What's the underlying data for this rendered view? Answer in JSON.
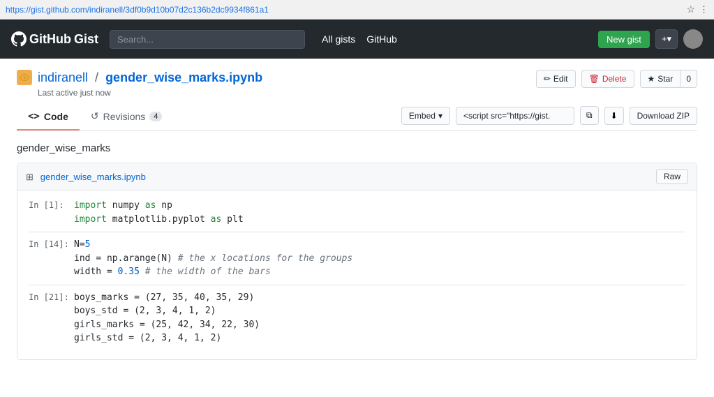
{
  "addressBar": {
    "url": "https://gist.github.com/indiranell/3df0b9d10b07d2c136b2dc9934f861a1"
  },
  "header": {
    "logo": {
      "github": "GitHub",
      "gist": "Gist"
    },
    "search": {
      "placeholder": "Search..."
    },
    "nav": [
      {
        "label": "All gists"
      },
      {
        "label": "GitHub"
      }
    ],
    "newGist": "New gist",
    "plusBtn": "+"
  },
  "gist": {
    "owner": "indiranell",
    "separator": "/",
    "filename": "gender_wise_marks.ipynb",
    "lastActive": "Last active just now",
    "actions": {
      "edit": "Edit",
      "delete": "Delete",
      "star": "Star",
      "starCount": "0"
    }
  },
  "tabs": [
    {
      "label": "Code",
      "icon": "<>",
      "active": true
    },
    {
      "label": "Revisions",
      "icon": "↺",
      "count": "4",
      "active": false
    }
  ],
  "tabActions": {
    "embed": "Embed",
    "embedDropdownIcon": "▾",
    "embedValue": "<script src=\"https://gist.",
    "downloadZip": "Download ZIP"
  },
  "gistName": "gender_wise_marks",
  "file": {
    "name": "gender_wise_marks.ipynb",
    "rawBtn": "Raw"
  },
  "codeCells": [
    {
      "label": "In [1]:",
      "lines": [
        {
          "tokens": [
            {
              "text": "import ",
              "class": "code-green"
            },
            {
              "text": "numpy",
              "class": "code-black"
            },
            {
              "text": " as ",
              "class": "code-green"
            },
            {
              "text": "np",
              "class": "code-black"
            }
          ]
        },
        {
          "tokens": [
            {
              "text": "import ",
              "class": "code-green"
            },
            {
              "text": "matplotlib.pyplot",
              "class": "code-black"
            },
            {
              "text": " as ",
              "class": "code-green"
            },
            {
              "text": "plt",
              "class": "code-black"
            }
          ]
        }
      ]
    },
    {
      "label": "In [14]:",
      "lines": [
        {
          "tokens": [
            {
              "text": "N",
              "class": "code-black"
            },
            {
              "text": "=",
              "class": "code-black"
            },
            {
              "text": "5",
              "class": "code-blue"
            }
          ]
        },
        {
          "tokens": [
            {
              "text": "ind ",
              "class": "code-black"
            },
            {
              "text": "= ",
              "class": "code-black"
            },
            {
              "text": "np.arange(N)",
              "class": "code-black"
            },
            {
              "text": "  # the x locations for the groups",
              "class": "code-comment"
            }
          ]
        },
        {
          "tokens": [
            {
              "text": "width ",
              "class": "code-black"
            },
            {
              "text": "= ",
              "class": "code-black"
            },
            {
              "text": "0.35",
              "class": "code-blue"
            },
            {
              "text": "        # the width of the bars",
              "class": "code-comment"
            }
          ]
        }
      ]
    },
    {
      "label": "In [21]:",
      "lines": [
        {
          "tokens": [
            {
              "text": "boys_marks = (27, 35, 40, 35, 29)",
              "class": "code-black"
            }
          ]
        },
        {
          "tokens": [
            {
              "text": "boys_std = (2, 3, 4, 1, 2)",
              "class": "code-black"
            }
          ]
        },
        {
          "tokens": [
            {
              "text": "girls_marks = (25, 42, 34, 22, 30)",
              "class": "code-black"
            }
          ]
        },
        {
          "tokens": [
            {
              "text": "girls_std = (2, 3, 4, 1, 2)",
              "class": "code-black"
            }
          ]
        }
      ]
    }
  ]
}
